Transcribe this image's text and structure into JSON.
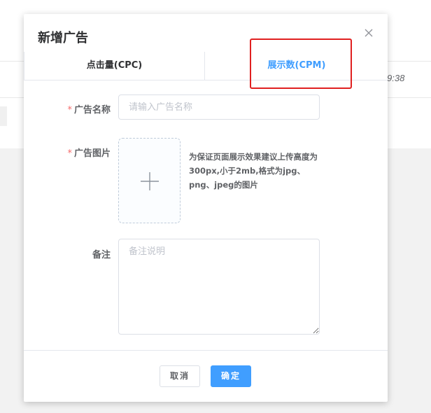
{
  "background": {
    "time_fragment": "9:38"
  },
  "dialog": {
    "title": "新增广告",
    "close_icon": "close-icon"
  },
  "tabs": [
    {
      "label": "点击量(CPC)",
      "active": false
    },
    {
      "label": "展示数(CPM)",
      "active": true
    }
  ],
  "form": {
    "name": {
      "label": "广告名称",
      "required": true,
      "placeholder": "请输入广告名称",
      "value": ""
    },
    "image": {
      "label": "广告图片",
      "required": true,
      "upload_icon": "plus-icon",
      "tip": "为保证页面展示效果建议上传高度为300px,小于2mb,格式为jpg、png、jpeg的图片"
    },
    "remark": {
      "label": "备注",
      "placeholder": "备注说明",
      "value": ""
    }
  },
  "footer": {
    "cancel_label": "取消",
    "confirm_label": "确定"
  },
  "colors": {
    "primary": "#409eff",
    "required_star": "#f56c6c",
    "highlight_box": "#e02020"
  }
}
